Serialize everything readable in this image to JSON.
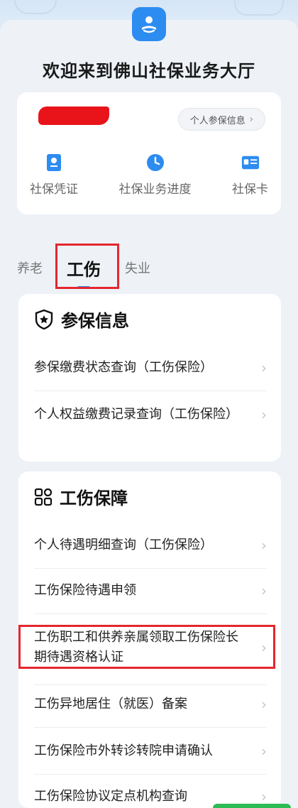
{
  "header": {
    "welcome": "欢迎来到佛山社保业务大厅"
  },
  "user_card": {
    "info_button": "个人参保信息",
    "quick_actions": [
      {
        "label": "社保凭证",
        "icon": "certificate-icon"
      },
      {
        "label": "社保业务进度",
        "icon": "clock-icon"
      },
      {
        "label": "社保卡",
        "icon": "card-icon"
      }
    ]
  },
  "tabs": [
    {
      "label": "养老"
    },
    {
      "label": "工伤"
    },
    {
      "label": "失业"
    }
  ],
  "section1": {
    "title": "参保信息",
    "items": [
      "参保缴费状态查询（工伤保险）",
      "个人权益缴费记录查询（工伤保险）"
    ]
  },
  "section2": {
    "title": "工伤保障",
    "items": [
      "个人待遇明细查询（工伤保险）",
      "工伤保险待遇申领",
      "工伤职工和供养亲属领取工伤保险长期待遇资格认证",
      "工伤异地居住（就医）备案",
      "工伤保险市外转诊转院申请确认",
      "工伤保险协议定点机构查询"
    ]
  },
  "colors": {
    "accent": "#2d8cf0",
    "highlight": "#e5262e",
    "background": "#eef2f7"
  }
}
